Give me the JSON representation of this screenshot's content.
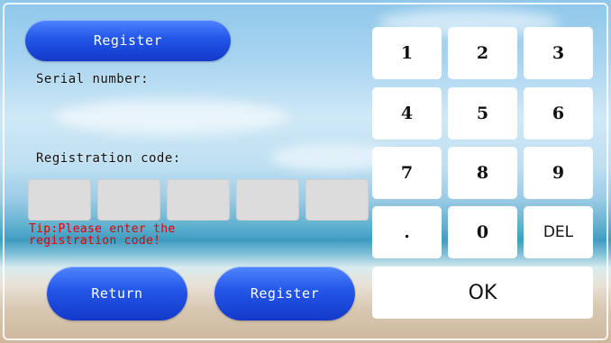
{
  "header": {
    "register_tab_label": "Register"
  },
  "form": {
    "serial_label": "Serial number:",
    "serial_value": "",
    "registration_label": "Registration code:",
    "code_boxes": [
      "",
      "",
      "",
      "",
      ""
    ],
    "tip": "Tip:Please enter the\nregistration code!"
  },
  "buttons": {
    "return_label": "Return",
    "register_label": "Register"
  },
  "keypad": {
    "keys": [
      "1",
      "2",
      "3",
      "4",
      "5",
      "6",
      "7",
      "8",
      "9",
      ".",
      "0",
      "DEL"
    ],
    "ok_label": "OK"
  },
  "colors": {
    "button_blue": "#2255e8",
    "tip_red": "#e00000",
    "key_bg": "#ffffff",
    "code_box_bg": "#dcdcdc"
  }
}
